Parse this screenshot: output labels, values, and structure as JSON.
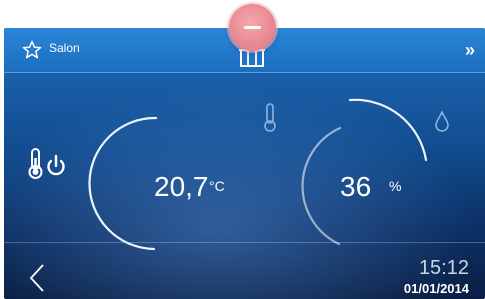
{
  "header": {
    "room_label": "Salon",
    "favorite_icon": "star-outline-icon",
    "building_icon": "building-icon",
    "next_label": "»"
  },
  "pull_tab": {
    "icon": "minus-icon",
    "color": "#e88a93"
  },
  "mode": {
    "icon": "thermometer-power-icon"
  },
  "temperature": {
    "value": "20,7",
    "unit": "°C",
    "icon": "thermometer-icon",
    "gauge_level": 0.5
  },
  "humidity": {
    "value": "36",
    "unit": "%",
    "icon": "water-drop-icon",
    "gauge_level": 0.36
  },
  "footer": {
    "back_icon": "chevron-left-icon",
    "time": "15:12",
    "date": "01/01/2014"
  },
  "colors": {
    "background_top": "#1f6fba",
    "background_bottom": "#0a1f44",
    "text": "#ffffff"
  }
}
